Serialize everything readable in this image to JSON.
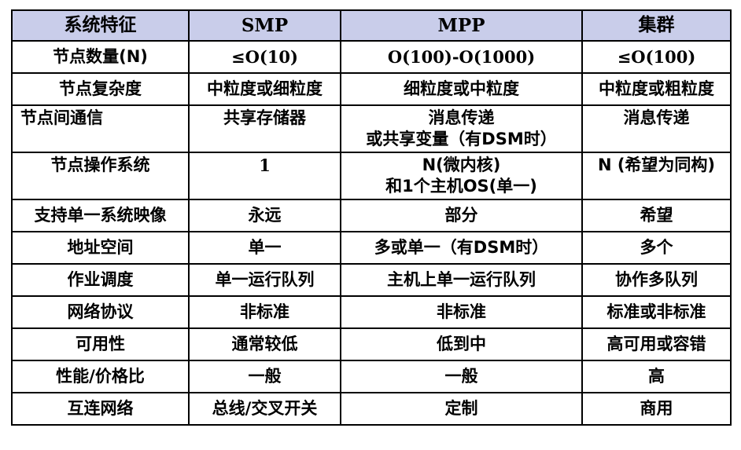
{
  "table": {
    "headers": [
      "系统特征",
      "SMP",
      "MPP",
      "集群"
    ],
    "rows": [
      {
        "feature": "节点数量(N)",
        "smp": "≤O(10)",
        "mpp": [
          "O(100)-O(1000)"
        ],
        "cluster": "≤O(100)"
      },
      {
        "feature": "节点复杂度",
        "smp": "中粒度或细粒度",
        "mpp": [
          "细粒度或中粒度"
        ],
        "cluster": "中粒度或粗粒度"
      },
      {
        "feature": "节点间通信",
        "smp": "共享存储器",
        "mpp": [
          "消息传递",
          "或共享变量（有DSM时）"
        ],
        "cluster": "消息传递"
      },
      {
        "feature": "节点操作系统",
        "smp": "1",
        "mpp": [
          "N(微内核)",
          "和1个主机OS(单一)"
        ],
        "cluster": "N (希望为同构)"
      },
      {
        "feature": "支持单一系统映像",
        "smp": "永远",
        "mpp": [
          "部分"
        ],
        "cluster": "希望"
      },
      {
        "feature": "地址空间",
        "smp": "单一",
        "mpp": [
          "多或单一（有DSM时）"
        ],
        "cluster": "多个"
      },
      {
        "feature": "作业调度",
        "smp": "单一运行队列",
        "mpp": [
          "主机上单一运行队列"
        ],
        "cluster": "协作多队列"
      },
      {
        "feature": "网络协议",
        "smp": "非标准",
        "mpp": [
          "非标准"
        ],
        "cluster": "标准或非标准"
      },
      {
        "feature": "可用性",
        "smp": "通常较低",
        "mpp": [
          "低到中"
        ],
        "cluster": "高可用或容错"
      },
      {
        "feature": "性能/价格比",
        "smp": "一般",
        "mpp": [
          "一般"
        ],
        "cluster": "高"
      },
      {
        "feature": "互连网络",
        "smp": "总线/交叉开关",
        "mpp": [
          "定制"
        ],
        "cluster": "商用"
      }
    ]
  },
  "colors": {
    "header_bg": "#c9cdea",
    "border": "#000000",
    "text": "#000000"
  }
}
